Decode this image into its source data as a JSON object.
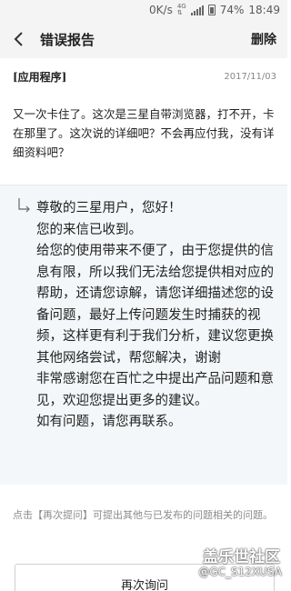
{
  "status_bar": {
    "network_speed": "0K/s",
    "network_type": "4G",
    "battery": "74%",
    "time": "18:49"
  },
  "app_bar": {
    "back_icon": "chevron-left-icon",
    "title": "错误报告",
    "delete_label": "删除"
  },
  "question": {
    "category": "[应用程序]",
    "date": "2017/11/03",
    "body": "又一次卡住了。这次是三星自带浏览器，打不开，卡在那里了。这次说的详细吧？不会再应付我，没有详细资料吧？"
  },
  "reply": {
    "icon": "reply-arrow-icon",
    "paragraphs": [
      "尊敬的三星用户，您好！",
      "您的来信已收到。",
      "给您的使用带来不便了，由于您提供的信息有限，所以我们无法给您提供相对应的帮助，还请您谅解，请您详细描述您的设备问题，最好上传问题发生时捕获的视频，这样更有利于我们分析，建议您更换其他网络尝试，帮您解决，谢谢",
      "非常感谢您在百忙之中提出产品问题和意见，欢迎您提出更多的建议。",
      "如有问题，请您再联系。"
    ]
  },
  "hint": "点击【再次提问】可提出其他与已发布的问题相关的问题。",
  "ask_again_label": "再次询问",
  "watermark": {
    "title": "盖乐世社区",
    "user": "@GC_S12XUSA"
  }
}
